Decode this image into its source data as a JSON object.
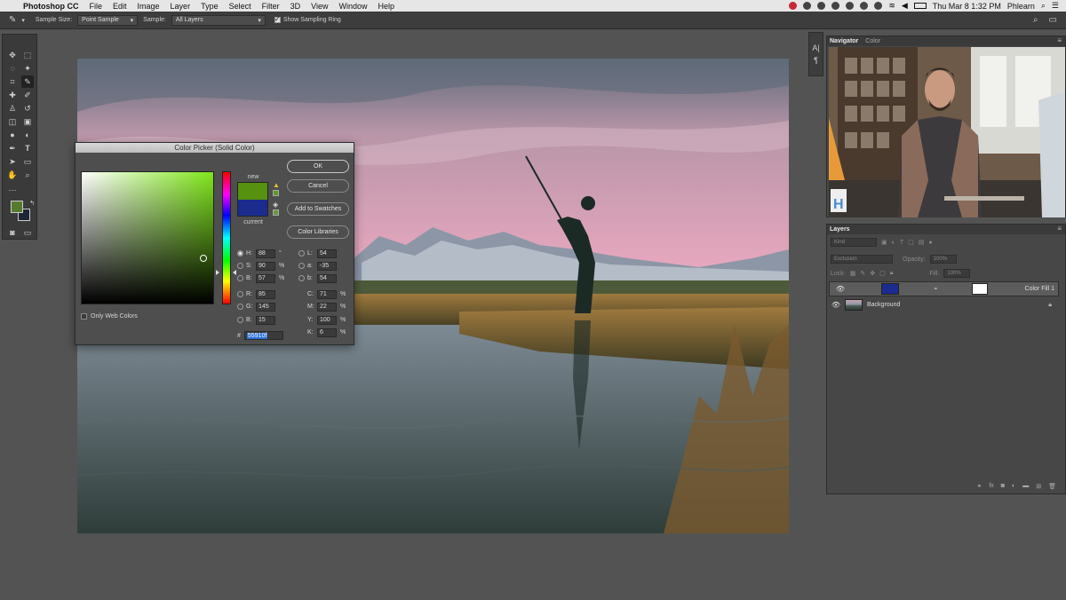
{
  "menubar": {
    "app": "Photoshop CC",
    "items": [
      "File",
      "Edit",
      "Image",
      "Layer",
      "Type",
      "Select",
      "Filter",
      "3D",
      "View",
      "Window",
      "Help"
    ],
    "clock": "Thu Mar 8  1:32 PM",
    "user": "Phlearn",
    "battery": "100%"
  },
  "options_bar": {
    "sample_size_label": "Sample Size:",
    "sample_size_value": "Point Sample",
    "sample_label": "Sample:",
    "sample_value": "All Layers",
    "sampling_ring_label": "Show Sampling Ring",
    "sampling_ring_checked": true
  },
  "toolbar": {
    "foreground_color": "#567a2e",
    "background_color": "#1d2536"
  },
  "color_picker": {
    "title": "Color Picker (Solid Color)",
    "new_label": "new",
    "current_label": "current",
    "new_color": "#56910f",
    "current_color": "#1b2c8e",
    "buttons": {
      "ok": "OK",
      "cancel": "Cancel",
      "add_swatches": "Add to Swatches",
      "color_libraries": "Color Libraries"
    },
    "hsb": {
      "h": {
        "label": "H:",
        "value": "88",
        "unit": "°"
      },
      "s": {
        "label": "S:",
        "value": "90",
        "unit": "%"
      },
      "b": {
        "label": "B:",
        "value": "57",
        "unit": "%"
      }
    },
    "rgb": {
      "r": {
        "label": "R:",
        "value": "85"
      },
      "g": {
        "label": "G:",
        "value": "145"
      },
      "b": {
        "label": "B:",
        "value": "15"
      }
    },
    "lab": {
      "l": {
        "label": "L:",
        "value": "54"
      },
      "a": {
        "label": "a:",
        "value": "-35"
      },
      "b": {
        "label": "b:",
        "value": "54"
      }
    },
    "cmyk": {
      "c": {
        "label": "C:",
        "value": "71",
        "unit": "%"
      },
      "m": {
        "label": "M:",
        "value": "22",
        "unit": "%"
      },
      "y": {
        "label": "Y:",
        "value": "100",
        "unit": "%"
      },
      "k": {
        "label": "K:",
        "value": "6",
        "unit": "%"
      }
    },
    "hex_label": "#",
    "hex_value": "55910f",
    "web_only_label": "Only Web Colors"
  },
  "navigator_panel": {
    "tabs": [
      "Navigator",
      "Color"
    ]
  },
  "layers_panel": {
    "title": "Layers",
    "kind_placeholder": "Kind",
    "blend_mode": "Exclusion",
    "opacity_label": "Opacity:",
    "opacity_value": "100%",
    "fill_label": "Fill:",
    "fill_value": "100%",
    "lock_label": "Lock:",
    "layers": [
      {
        "name": "Color Fill 1",
        "selected": true,
        "thumb_color": "#1b2c8e"
      },
      {
        "name": "Background",
        "selected": false,
        "thumb_color": "#6e7a80"
      }
    ]
  }
}
